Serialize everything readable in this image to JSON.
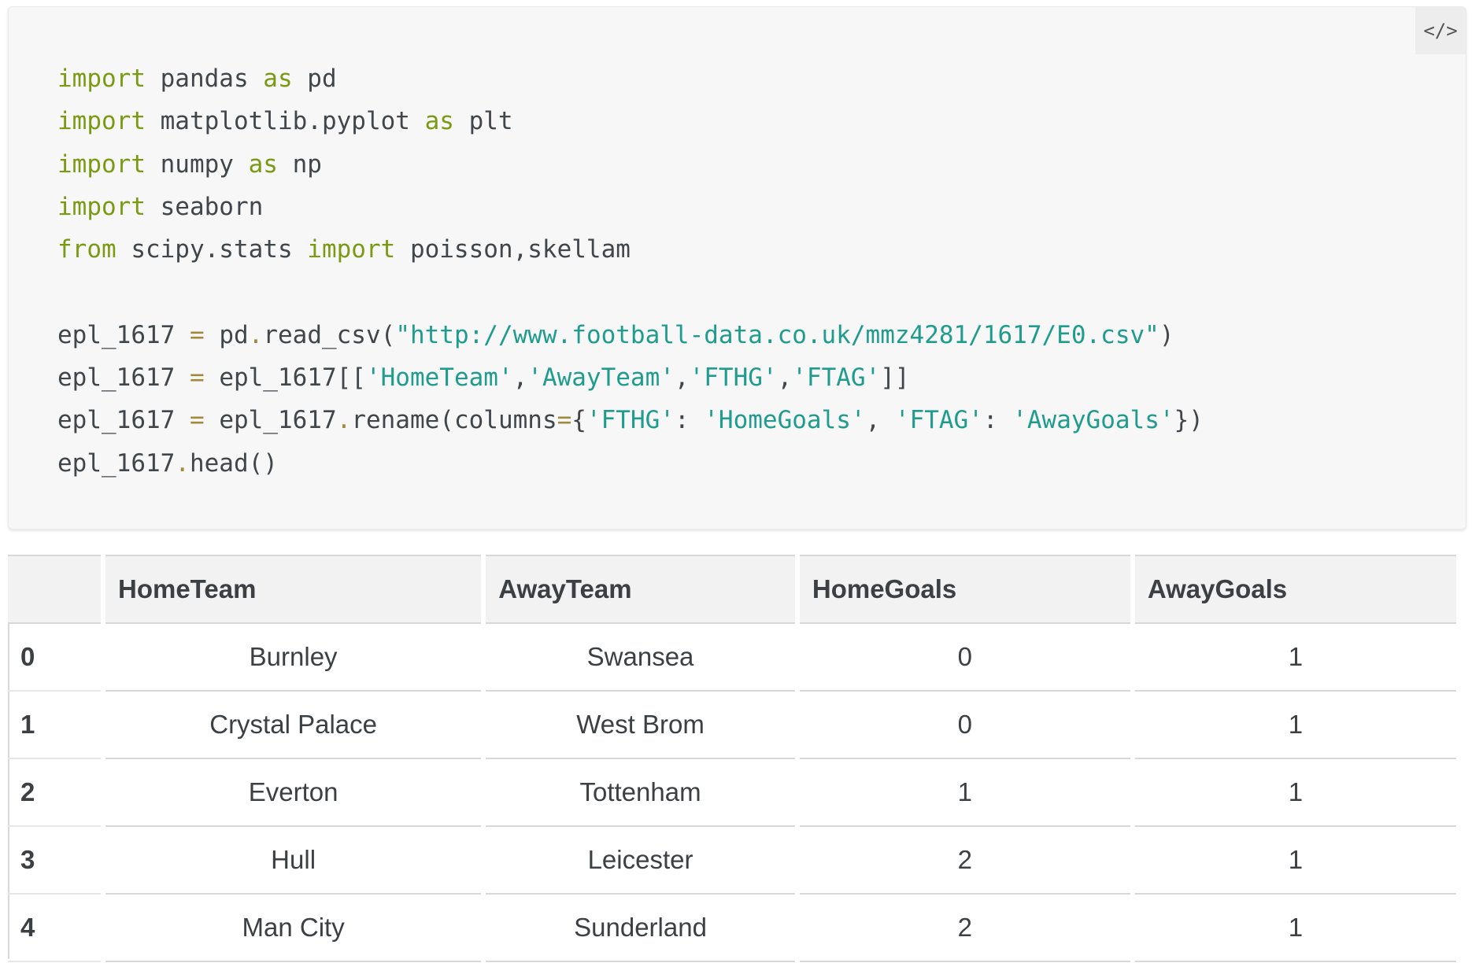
{
  "toggle": {
    "label": "</>"
  },
  "code": {
    "lines": [
      [
        [
          "kw",
          "import"
        ],
        [
          "t",
          " pandas "
        ],
        [
          "kw",
          "as"
        ],
        [
          "t",
          " pd"
        ]
      ],
      [
        [
          "kw",
          "import"
        ],
        [
          "t",
          " matplotlib.pyplot "
        ],
        [
          "kw",
          "as"
        ],
        [
          "t",
          " plt"
        ]
      ],
      [
        [
          "kw",
          "import"
        ],
        [
          "t",
          " numpy "
        ],
        [
          "kw",
          "as"
        ],
        [
          "t",
          " np"
        ]
      ],
      [
        [
          "kw",
          "import"
        ],
        [
          "t",
          " seaborn"
        ]
      ],
      [
        [
          "kw",
          "from"
        ],
        [
          "t",
          " scipy.stats "
        ],
        [
          "kw",
          "import"
        ],
        [
          "t",
          " poisson,skellam"
        ]
      ],
      [],
      [
        [
          "t",
          "epl_1617 "
        ],
        [
          "op",
          "="
        ],
        [
          "t",
          " pd"
        ],
        [
          "op",
          "."
        ],
        [
          "t",
          "read_csv("
        ],
        [
          "str",
          "\"http://www.football-data.co.uk/mmz4281/1617/E0.csv\""
        ],
        [
          "t",
          ")"
        ]
      ],
      [
        [
          "t",
          "epl_1617 "
        ],
        [
          "op",
          "="
        ],
        [
          "t",
          " epl_1617[["
        ],
        [
          "str",
          "'HomeTeam'"
        ],
        [
          "t",
          ","
        ],
        [
          "str",
          "'AwayTeam'"
        ],
        [
          "t",
          ","
        ],
        [
          "str",
          "'FTHG'"
        ],
        [
          "t",
          ","
        ],
        [
          "str",
          "'FTAG'"
        ],
        [
          "t",
          "]]"
        ]
      ],
      [
        [
          "t",
          "epl_1617 "
        ],
        [
          "op",
          "="
        ],
        [
          "t",
          " epl_1617"
        ],
        [
          "op",
          "."
        ],
        [
          "t",
          "rename(columns"
        ],
        [
          "op",
          "="
        ],
        [
          "t",
          "{"
        ],
        [
          "str",
          "'FTHG'"
        ],
        [
          "t",
          ": "
        ],
        [
          "str",
          "'HomeGoals'"
        ],
        [
          "t",
          ", "
        ],
        [
          "str",
          "'FTAG'"
        ],
        [
          "t",
          ": "
        ],
        [
          "str",
          "'AwayGoals'"
        ],
        [
          "t",
          "})"
        ]
      ],
      [
        [
          "t",
          "epl_1617"
        ],
        [
          "op",
          "."
        ],
        [
          "t",
          "head()"
        ]
      ]
    ]
  },
  "table": {
    "columns": [
      "",
      "HomeTeam",
      "AwayTeam",
      "HomeGoals",
      "AwayGoals"
    ],
    "rows": [
      [
        "0",
        "Burnley",
        "Swansea",
        "0",
        "1"
      ],
      [
        "1",
        "Crystal Palace",
        "West Brom",
        "0",
        "1"
      ],
      [
        "2",
        "Everton",
        "Tottenham",
        "1",
        "1"
      ],
      [
        "3",
        "Hull",
        "Leicester",
        "2",
        "1"
      ],
      [
        "4",
        "Man City",
        "Sunderland",
        "2",
        "1"
      ]
    ]
  },
  "colors": {
    "keyword": "#7b9a14",
    "string": "#1f9c8e",
    "operator": "#a08a3c",
    "code_bg": "#f7f7f7"
  }
}
